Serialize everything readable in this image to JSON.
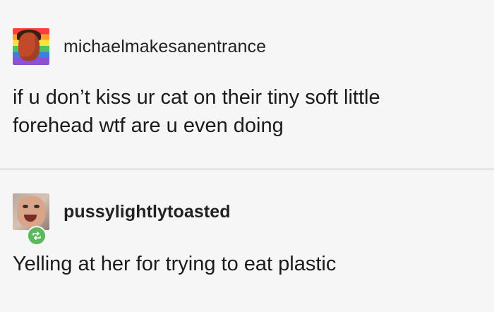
{
  "posts": [
    {
      "username": "michaelmakesanentrance",
      "avatar_icon": "user-avatar-icon",
      "text_line1": "if u don’t kiss ur cat on their tiny soft little",
      "text_line2": "forehead wtf are u even doing"
    },
    {
      "username": "pussylightlytoasted",
      "avatar_icon": "user-avatar-icon",
      "badge_icon": "reblog-icon",
      "badge_color": "#5bb85c",
      "text_line1": "Yelling at her for trying to eat plastic"
    }
  ]
}
